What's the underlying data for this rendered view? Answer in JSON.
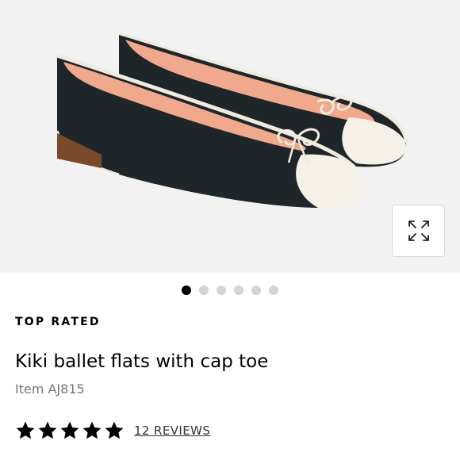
{
  "product": {
    "badge": "TOP RATED",
    "title": "Kiki ballet flats with cap toe",
    "item_number": "Item AJ815",
    "rating": 5,
    "rating_max": 5,
    "reviews_link": "12 REVIEWS"
  },
  "gallery": {
    "image_count": 6,
    "active_index": 0,
    "expand_icon": "expand-arrows-icon"
  },
  "colors": {
    "hero_background": "#f2f2f2",
    "shoe_body": "#1f2629",
    "cap_toe": "#f5f1e8",
    "lining": "#f1a98e",
    "active_dot": "#000000",
    "inactive_dot": "#d4d4d4"
  }
}
